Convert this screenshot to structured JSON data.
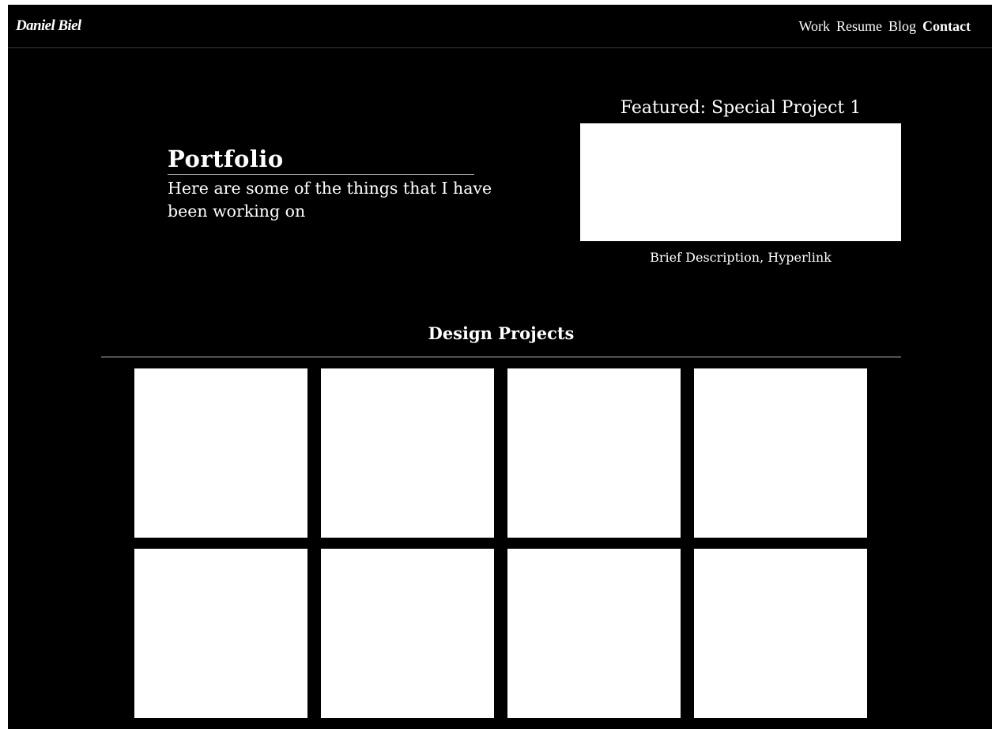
{
  "brand": "Daniel Biel",
  "nav": {
    "items": [
      {
        "label": "Work",
        "active": false
      },
      {
        "label": "Resume",
        "active": false
      },
      {
        "label": "Blog",
        "active": false
      },
      {
        "label": "Contact",
        "active": true
      }
    ]
  },
  "hero": {
    "title": "Portfolio",
    "subtitle": "Here are some of the things that I have been working on"
  },
  "featured": {
    "title": "Featured: Special Project 1",
    "description": "Brief Description, Hyperlink"
  },
  "design_projects": {
    "title": "Design Projects",
    "tiles": [
      "",
      "",
      "",
      "",
      "",
      "",
      "",
      ""
    ]
  },
  "colors": {
    "background": "#000000",
    "text": "#ffffff",
    "tile": "#ffffff",
    "rule": "#bdbdbd"
  }
}
